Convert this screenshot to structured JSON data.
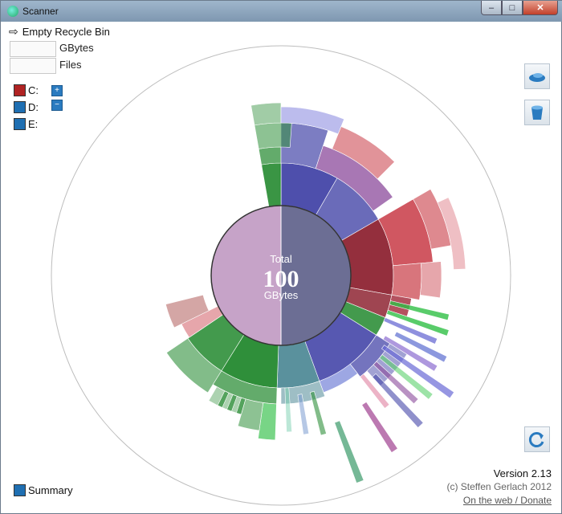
{
  "window": {
    "title": "Scanner",
    "buttons": {
      "minimize": "–",
      "maximize": "□",
      "close": "✕"
    }
  },
  "toolbar": {
    "empty_recycle_bin": "Empty Recycle Bin"
  },
  "stats": {
    "gbytes_value": "",
    "gbytes_label": "GBytes",
    "files_value": "",
    "files_label": "Files"
  },
  "drives": [
    {
      "label": "C:",
      "color": "#b02323"
    },
    {
      "label": "D:",
      "color": "#1f6fb2"
    },
    {
      "label": "E:",
      "color": "#1f6fb2"
    }
  ],
  "drive_buttons": {
    "expand": "+",
    "collapse": "−"
  },
  "center": {
    "caption": "Total",
    "value": "100",
    "unit": "GBytes"
  },
  "footer": {
    "summary": "Summary",
    "version": "Version 2.13",
    "copyright": "(c) Steffen Gerlach 2012",
    "link": "On the web / Donate"
  },
  "icons": {
    "titlebar": "scanner-app-icon",
    "empty": "arrow-right-icon",
    "right_top": "recycle-bin-icon",
    "right_mid": "delete-bin-icon",
    "right_bottom": "refresh-icon",
    "summary": "summary-icon"
  },
  "colors": {
    "free_space": "#c6a3c8",
    "used_space": "#6c6e94",
    "red": "#c83a45",
    "green": "#2f8f3a",
    "blue": "#4546a8"
  }
}
